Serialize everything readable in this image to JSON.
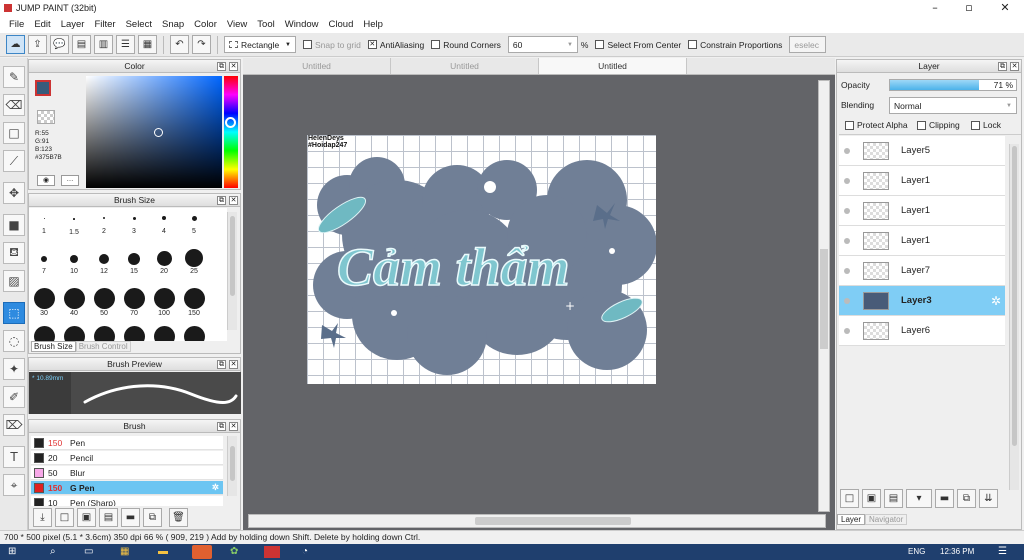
{
  "window": {
    "title": "JUMP PAINT (32bit)",
    "minimize": "–",
    "restore": "▫",
    "close": "✕"
  },
  "menu": [
    "File",
    "Edit",
    "Layer",
    "Filter",
    "Select",
    "Snap",
    "Color",
    "View",
    "Tool",
    "Window",
    "Cloud",
    "Help"
  ],
  "toolbar": {
    "shape_select": "Rectangle",
    "snap_to_grid": "Snap to grid",
    "antialiasing": "AntiAliasing",
    "round_corners": "Round Corners",
    "round_value": "60",
    "percent": "%",
    "select_from_center": "Select From Center",
    "constrain": "Constrain Proportions",
    "deselect": "eselec"
  },
  "color_panel": {
    "title": "Color",
    "r": "R:55",
    "g": "G:91",
    "b": "B:123",
    "hex": "#375B7B",
    "primary": "#375B7B"
  },
  "brush_size_panel": {
    "title": "Brush Size",
    "sizes": [
      "1",
      "1.5",
      "2",
      "3",
      "4",
      "5",
      "7",
      "10",
      "12",
      "15",
      "20",
      "25",
      "30",
      "40",
      "50",
      "70",
      "100",
      "150",
      "",
      "",
      "",
      "",
      "",
      ""
    ],
    "tabs": [
      "Brush Size",
      "Brush Control"
    ]
  },
  "brush_preview": {
    "title": "Brush Preview",
    "size": "10.89mm"
  },
  "brush_panel": {
    "title": "Brush",
    "items": [
      {
        "size": "150",
        "name": "Pen",
        "color": "#222222"
      },
      {
        "size": "20",
        "name": "Pencil",
        "color": "#222222"
      },
      {
        "size": "50",
        "name": "Blur",
        "color": "#f7a8e8"
      },
      {
        "size": "150",
        "name": "G Pen",
        "color": "#e02020"
      },
      {
        "size": "10",
        "name": "Pen (Sharp)",
        "color": "#222222"
      }
    ]
  },
  "doc_tabs": [
    "Untitled",
    "Untitled",
    "Untitled"
  ],
  "canvas": {
    "credit1": "HelenDeys",
    "credit2": "#Hoidap247",
    "artwork_text": "Cảm thẩm"
  },
  "layer_panel": {
    "title": "Layer",
    "opacity_label": "Opacity",
    "opacity_value": "71 %",
    "opacity": 0.71,
    "blending_label": "Blending",
    "blending_value": "Normal",
    "protect_alpha": "Protect Alpha",
    "clipping": "Clipping",
    "lock": "Lock",
    "layers": [
      "Layer5",
      "Layer1",
      "Layer1",
      "Layer1",
      "Layer7",
      "Layer3",
      "Layer6"
    ],
    "tabs": [
      "Layer",
      "Navigator"
    ]
  },
  "status": "700 * 500 pixel   (5.1 * 3.6cm)   350 dpi   66 %   ( 909, 219 )   Add by holding down Shift. Delete by holding down Ctrl.",
  "taskbar": {
    "lang": "ENG",
    "time": "12:36 PM"
  }
}
